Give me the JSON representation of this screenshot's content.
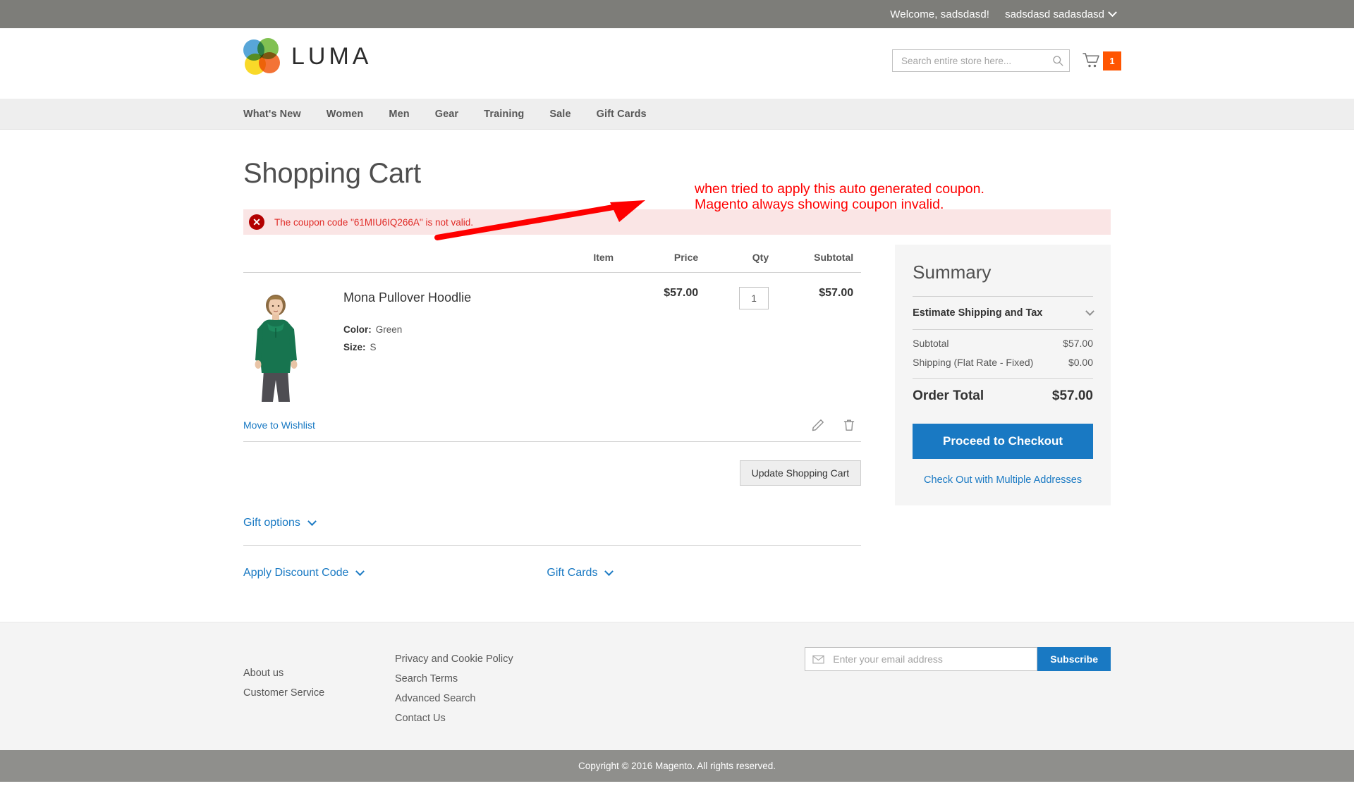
{
  "top_panel": {
    "welcome": "Welcome, sadsdasd!",
    "customer_name": "sadsdasd sadasdasd"
  },
  "header": {
    "logo_text": "LUMA",
    "search": {
      "placeholder": "Search entire store here...",
      "value": ""
    },
    "cart_count": "1"
  },
  "nav": {
    "items": [
      {
        "label": "What's New"
      },
      {
        "label": "Women"
      },
      {
        "label": "Men"
      },
      {
        "label": "Gear"
      },
      {
        "label": "Training"
      },
      {
        "label": "Sale"
      },
      {
        "label": "Gift Cards"
      }
    ]
  },
  "annotation": {
    "line1": "when tried to apply this auto generated coupon.",
    "line2": "Magento always showing coupon invalid.",
    "color": "#fe0000"
  },
  "page": {
    "title": "Shopping Cart"
  },
  "error": {
    "icon": "error-x-icon",
    "message": "The coupon code \"61MIU6IQ266A\" is not valid.",
    "bg_color": "#fae5e5",
    "text_color": "#e02b27"
  },
  "cart": {
    "columns": {
      "item": "Item",
      "price": "Price",
      "qty": "Qty",
      "subtotal": "Subtotal"
    },
    "rows": [
      {
        "name": "Mona Pullover Hoodlie",
        "options": [
          {
            "label": "Color:",
            "value": "Green"
          },
          {
            "label": "Size:",
            "value": "S"
          }
        ],
        "price": "$57.00",
        "qty": "1",
        "subtotal": "$57.00"
      }
    ],
    "wishlist_label": "Move to Wishlist",
    "update_label": "Update Shopping Cart",
    "gift_options_label": "Gift options",
    "apply_discount_label": "Apply Discount Code",
    "gift_cards_label": "Gift Cards"
  },
  "summary": {
    "title": "Summary",
    "estimate_label": "Estimate Shipping and Tax",
    "lines": [
      {
        "label": "Subtotal",
        "value": "$57.00"
      },
      {
        "label": "Shipping (Flat Rate - Fixed)",
        "value": "$0.00"
      }
    ],
    "order_total_label": "Order Total",
    "order_total_value": "$57.00",
    "checkout_label": "Proceed to Checkout",
    "multi_address_label": "Check Out with Multiple Addresses",
    "accent_color": "#1979c3"
  },
  "footer": {
    "column1": [
      {
        "label": "About us"
      },
      {
        "label": "Customer Service"
      }
    ],
    "column2": [
      {
        "label": "Privacy and Cookie Policy"
      },
      {
        "label": "Search Terms"
      },
      {
        "label": "Advanced Search"
      },
      {
        "label": "Contact Us"
      }
    ],
    "newsletter": {
      "placeholder": "Enter your email address",
      "value": "",
      "button_label": "Subscribe"
    },
    "copyright": "Copyright © 2016 Magento. All rights reserved."
  }
}
